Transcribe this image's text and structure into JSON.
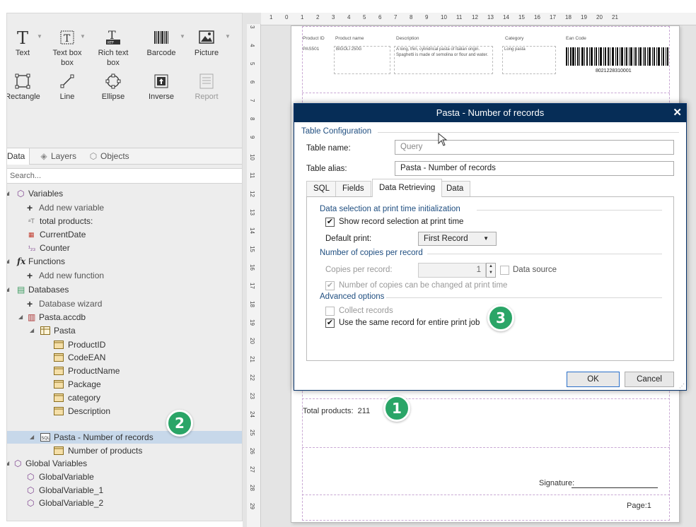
{
  "toolbox": {
    "row1": [
      "Text",
      "Text box",
      "Rich text box",
      "Barcode",
      "Picture"
    ],
    "row2": [
      "Rectangle",
      "Line",
      "Ellipse",
      "Inverse",
      "Report"
    ]
  },
  "panel_tabs": [
    "Data",
    "Layers",
    "Objects"
  ],
  "search": {
    "placeholder": "Search..."
  },
  "tree": {
    "variables": "Variables",
    "add_variable": "Add new variable",
    "var1": "total products:",
    "var2": "CurrentDate",
    "var3": "Counter",
    "functions": "Functions",
    "add_function": "Add new function",
    "databases": "Databases",
    "db_wizard": "Database wizard",
    "db_file": "Pasta.accdb",
    "table": "Pasta",
    "fields": [
      "ProductID",
      "CodeEAN",
      "ProductName",
      "Package",
      "category",
      "Description"
    ],
    "query": "Pasta - Number of records",
    "query_field": "Number of products",
    "global_vars": "Global Variables",
    "globals": [
      "GlobalVariable",
      "GlobalVariable_1",
      "GlobalVariable_2"
    ]
  },
  "ruler_h": [
    "1",
    "0",
    "1",
    "2",
    "3",
    "4",
    "5",
    "6",
    "7",
    "8",
    "9",
    "10",
    "11",
    "12",
    "13",
    "14",
    "15",
    "16",
    "17",
    "18",
    "19",
    "20",
    "21"
  ],
  "ruler_v": [
    "3",
    "4",
    "5",
    "6",
    "7",
    "8",
    "9",
    "10",
    "11",
    "12",
    "13",
    "14",
    "15",
    "16",
    "17",
    "18",
    "19",
    "20",
    "21",
    "22",
    "23",
    "24",
    "25",
    "26",
    "27",
    "28",
    "29"
  ],
  "label": {
    "headers": [
      "Product ID",
      "Product name",
      "Description",
      "Category",
      "Ean Code"
    ],
    "row": {
      "id": "PAS501",
      "name": "BIGOLI 250G",
      "description": "A long, thin, cylindrical pasta of Italian origin. Spaghetti is made of semolina or flour and water.",
      "category": "Long pasta",
      "ean": "8021228310001"
    },
    "total_label": "Total products:",
    "total_value": "211",
    "signature": "Signature:",
    "page": "Page:1"
  },
  "badges": [
    "1",
    "2",
    "3"
  ],
  "dialog": {
    "title": "Pasta - Number of records",
    "table_config": "Table Configuration",
    "table_name_label": "Table name:",
    "table_name_value": "Query",
    "table_alias_label": "Table alias:",
    "table_alias_value": "Pasta - Number of records",
    "tabs": [
      "SQL",
      "Fields",
      "Data Retrieving",
      "Data"
    ],
    "sect_selection": "Data selection at print time initialization",
    "show_selection": "Show record selection at print time",
    "default_print_label": "Default print:",
    "default_print_value": "First Record",
    "sect_copies": "Number of copies per record",
    "copies_label": "Copies per record:",
    "copies_value": "1",
    "data_source": "Data source",
    "copies_changed": "Number of copies can be changed at print time",
    "sect_advanced": "Advanced options",
    "collect": "Collect records",
    "same_record": "Use the same record for entire print job",
    "ok": "OK",
    "cancel": "Cancel"
  }
}
